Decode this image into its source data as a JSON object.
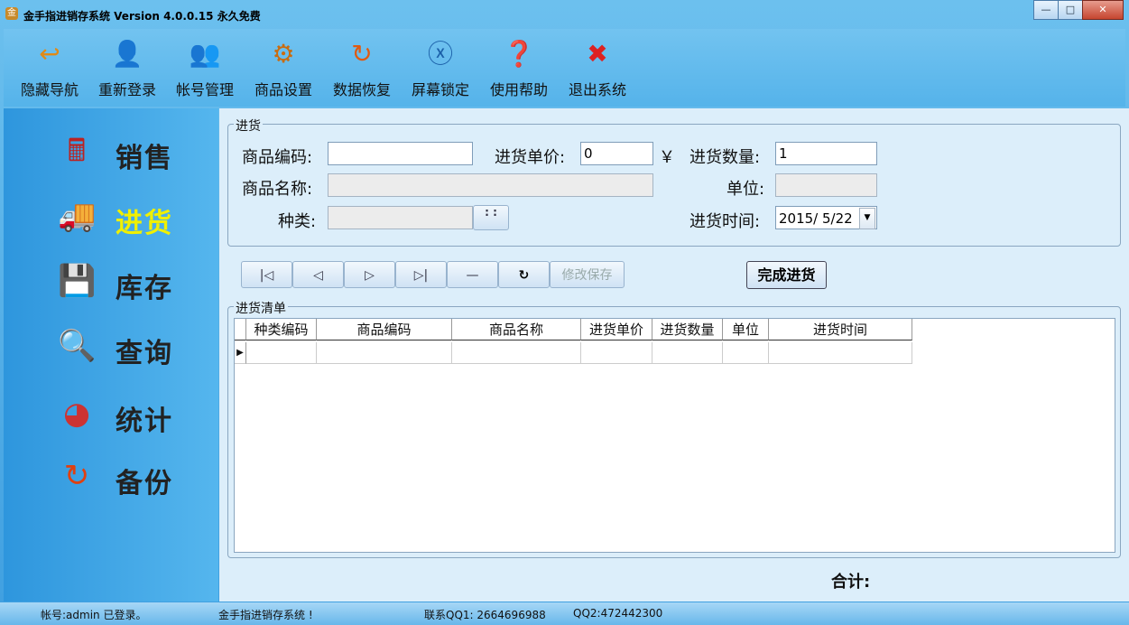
{
  "window": {
    "title": "金手指进销存系统     Version 4.0.0.15  永久免费"
  },
  "toolbar": [
    {
      "label": "隐藏导航",
      "icon": "arrow-back-icon"
    },
    {
      "label": "重新登录",
      "icon": "user-login-icon"
    },
    {
      "label": "帐号管理",
      "icon": "users-icon"
    },
    {
      "label": "商品设置",
      "icon": "gear-box-icon"
    },
    {
      "label": "数据恢复",
      "icon": "refresh-icon"
    },
    {
      "label": "屏幕锁定",
      "icon": "lock-x-icon"
    },
    {
      "label": "使用帮助",
      "icon": "help-icon"
    },
    {
      "label": "退出系统",
      "icon": "close-red-icon"
    }
  ],
  "sidebar": [
    {
      "label": "销售",
      "icon": "cash-register-icon",
      "active": false
    },
    {
      "label": "进货",
      "icon": "truck-icon",
      "active": true
    },
    {
      "label": "库存",
      "icon": "floppy-icon",
      "active": false
    },
    {
      "label": "查询",
      "icon": "magnifier-icon",
      "active": false
    },
    {
      "label": "统计",
      "icon": "pie-chart-icon",
      "active": false
    },
    {
      "label": "备份",
      "icon": "refresh-icon",
      "active": false
    }
  ],
  "purchase": {
    "legend": "进货",
    "code_label": "商品编码:",
    "code_value": "",
    "price_label": "进货单价:",
    "price_value": "0",
    "currency": "￥",
    "qty_label": "进货数量:",
    "qty_value": "1",
    "name_label": "商品名称:",
    "name_value": "",
    "unit_label": "单位:",
    "unit_value": "",
    "category_label": "种类:",
    "category_value": "",
    "category_button": ": :",
    "date_label": "进货时间:",
    "date_value": "2015/ 5/22"
  },
  "nav": {
    "first": "|◁",
    "prev": "◁",
    "next": "▷",
    "last": "▷|",
    "minus": "—",
    "refresh": "↻",
    "save": "修改保存",
    "complete": "完成进货"
  },
  "list": {
    "legend": "进货清单",
    "columns": [
      "种类编码",
      "商品编码",
      "商品名称",
      "进货单价",
      "进货数量",
      "单位",
      "进货时间"
    ],
    "row_marker": "▶"
  },
  "total_label": "合计:",
  "status": {
    "account": "帐号:admin 已登录。",
    "app": "金手指进销存系统 !",
    "qq1": "联系QQ1: 2664696988",
    "qq2": "QQ2:472442300"
  }
}
